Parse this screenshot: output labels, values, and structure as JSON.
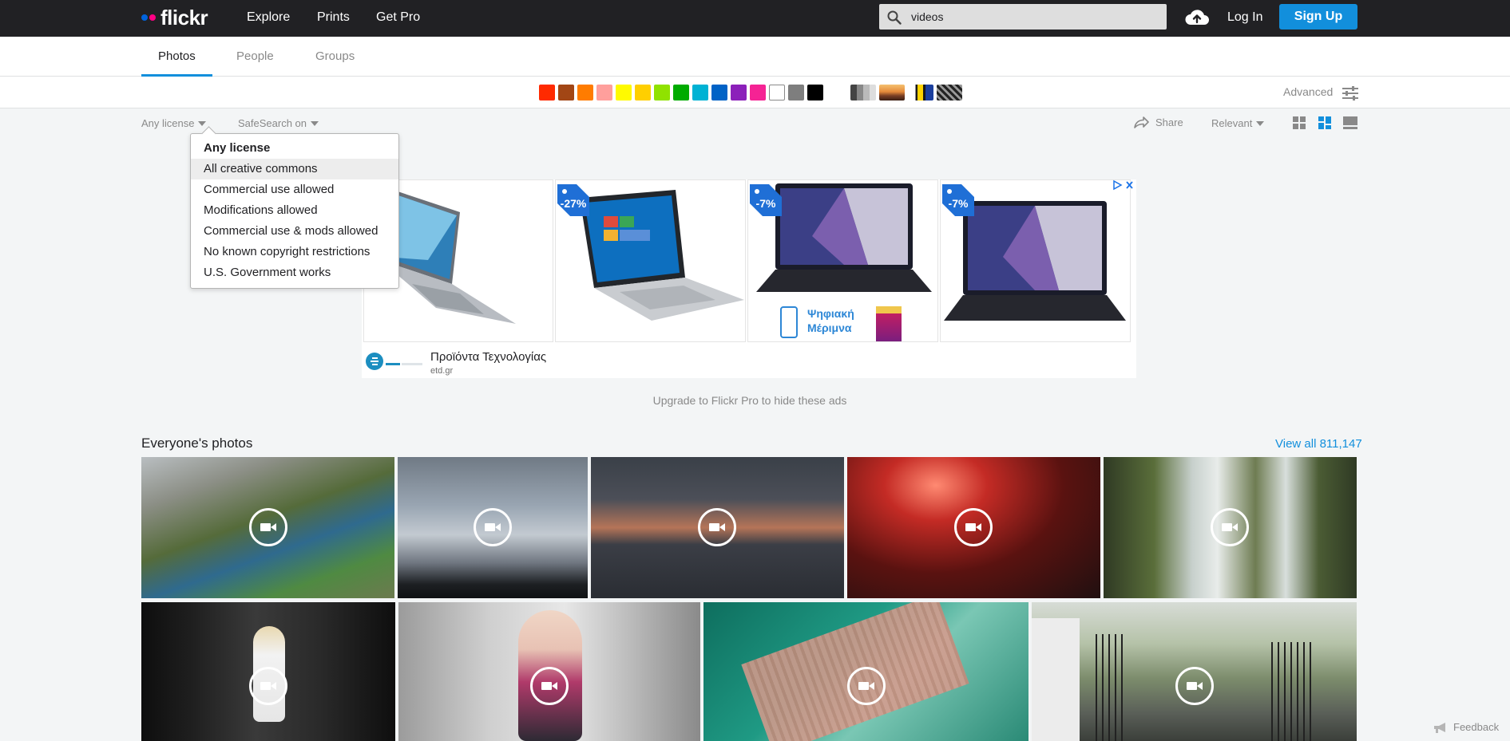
{
  "app": {
    "logo_text": "flickr",
    "brand_colors": {
      "blue": "#0063dc",
      "pink": "#ff0084",
      "accent": "#128fdc"
    }
  },
  "topnav": {
    "links": [
      "Explore",
      "Prints",
      "Get Pro"
    ],
    "search_value": "videos",
    "search_icon": "search-icon",
    "upload_icon": "cloud-upload-icon",
    "login_label": "Log In",
    "signup_label": "Sign Up"
  },
  "tabs": [
    {
      "label": "Photos",
      "active": true
    },
    {
      "label": "People",
      "active": false
    },
    {
      "label": "Groups",
      "active": false
    }
  ],
  "color_filters": [
    "#ff2a00",
    "#a24615",
    "#ff7c00",
    "#ff9f9c",
    "#fffa00",
    "#ffcf00",
    "#90e200",
    "#00ab00",
    "#00b2d4",
    "#0062c6",
    "#8c20ba",
    "#f52394",
    "#ffffff",
    "#7e7e7e",
    "#000000"
  ],
  "style_filters": [
    "black-and-white",
    "shallow-depth-of-field",
    "minimalism",
    "patterns"
  ],
  "advanced_label": "Advanced",
  "filters": {
    "license_label": "Any license",
    "safesearch_label": "SafeSearch on",
    "share_label": "Share",
    "sort_label": "Relevant"
  },
  "license_dropdown": {
    "items": [
      "Any license",
      "All creative commons",
      "Commercial use allowed",
      "Modifications allowed",
      "Commercial use & mods allowed",
      "No known copyright restrictions",
      "U.S. Government works"
    ],
    "selected_index": 0,
    "hovered_index": 1
  },
  "ad": {
    "badges": [
      "-27%",
      "-7%",
      "-7%"
    ],
    "promo_text": "Ψηφιακή\nΜέριμνα",
    "title": "Προϊόντα Τεχνολογίας",
    "domain": "etd.gr",
    "upgrade_text": "Upgrade to Flickr Pro to hide these ads"
  },
  "photos": {
    "section_title": "Everyone's photos",
    "view_all_label": "View all 811,147"
  },
  "feedback_label": "Feedback"
}
